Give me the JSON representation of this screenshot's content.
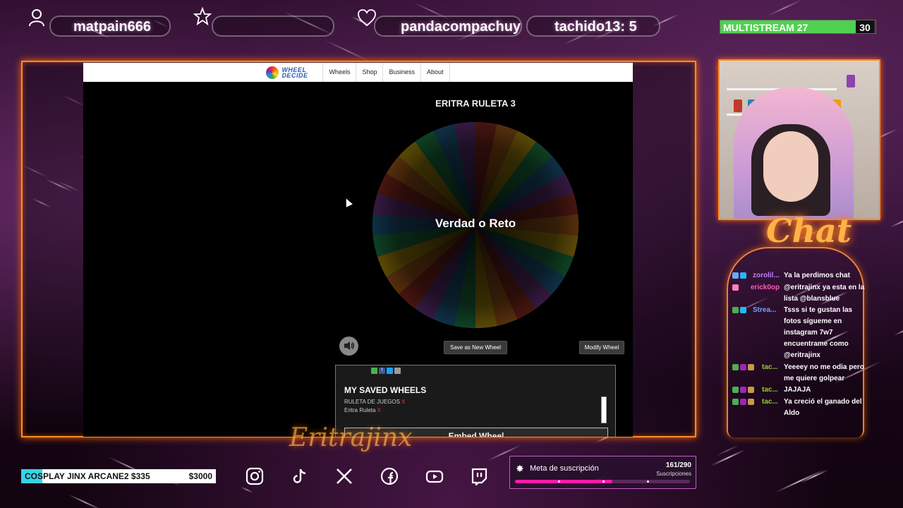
{
  "top": {
    "user1": "matpain666",
    "user2": "pandacompachuy",
    "user3": "tachido13: 5",
    "multistream_label": "MULTISTREAM",
    "multistream_value": "27",
    "multistream_target": "30",
    "multistream_progress": 0.9
  },
  "site": {
    "logo_text": "WHEEL DECIDE",
    "nav": [
      "Wheels",
      "Shop",
      "Business",
      "About"
    ],
    "wheel_title": "ERITRA RULETA 3",
    "wheel_center": "Verdad o Reto",
    "save_button": "Save as New Wheel",
    "modify_button": "Modify Wheel",
    "saved_title": "MY SAVED WHEELS",
    "saved_items": [
      "RULETA DE JUEGOS",
      "Eritra Ruleta"
    ],
    "remove_mark": "X",
    "embed_button": "Embed Wheel"
  },
  "chat": {
    "title": "Chat",
    "messages": [
      {
        "user": "zorolil...",
        "color": "#c080ff",
        "text": "Ya la perdimos chat"
      },
      {
        "user": "erick0op",
        "color": "#ff5ab8",
        "text": "@eritrajinx ya esta en la lista @blansblue"
      },
      {
        "user": "Strea...",
        "color": "#6aa8ff",
        "text": "Tsss si te gustan las fotos sígueme en instagram 7w7 encuentrame como @eritrajinx"
      },
      {
        "user": "tac...",
        "color": "#9acd32",
        "text": "Yeeeey no me odia pero me quiere golpear"
      },
      {
        "user": "tac...",
        "color": "#9acd32",
        "text": "JAJAJA"
      },
      {
        "user": "tac...",
        "color": "#9acd32",
        "text": "Ya creció el ganado del Aldo"
      }
    ]
  },
  "goal": {
    "name": "COSPLAY JINX ARCANE2 $335",
    "target": "$3000",
    "progress": 0.11
  },
  "subs": {
    "label": "Meta de suscripción",
    "count": "161/290",
    "caption": "Suscripciones",
    "progress": 0.555
  },
  "colors": {
    "frame": "#ff8a2a",
    "multistream": "#4fd14f",
    "goal": "#35d4e6",
    "subs": "#ff1aa8"
  },
  "icons": [
    "user-icon",
    "star-icon",
    "heart-icon",
    "instagram-icon",
    "tiktok-icon",
    "x-icon",
    "facebook-icon",
    "youtube-icon",
    "twitch-icon",
    "sound-icon",
    "cursor-icon"
  ]
}
